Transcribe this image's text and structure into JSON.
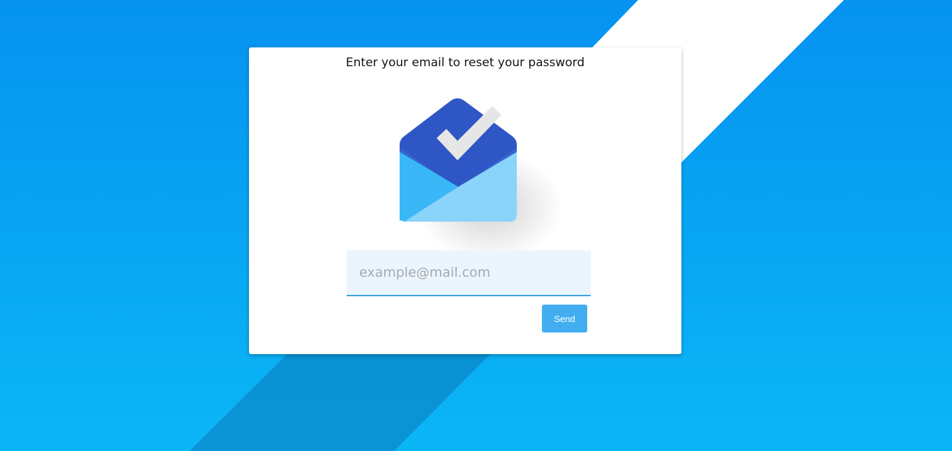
{
  "reset_form": {
    "title": "Enter your email to reset your password",
    "email_placeholder": "example@mail.com",
    "email_value": "",
    "send_label": "Send"
  },
  "logo": {
    "icon": "inbox-envelope-checkmark-icon"
  },
  "colors": {
    "background_top": "#0592f0",
    "background_bottom": "#0bb6f6",
    "card": "#ffffff",
    "input_background": "#ebf5fd",
    "input_underline": "#3aa4e4",
    "button": "#42aef0",
    "envelope_flap": "#2f56c5",
    "envelope_body_light": "#8ad3fb",
    "envelope_body": "#3ab7f6"
  }
}
